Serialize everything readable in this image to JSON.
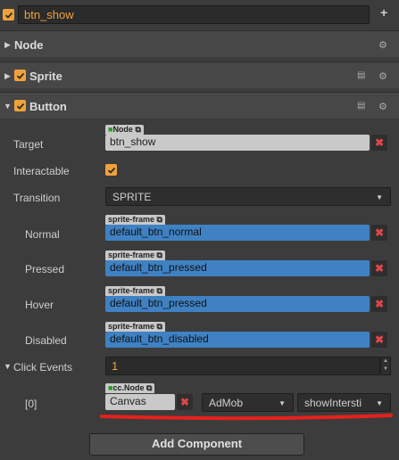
{
  "node": {
    "name": "btn_show",
    "enabled": true
  },
  "sections": {
    "node": {
      "title": "Node"
    },
    "sprite": {
      "title": "Sprite",
      "enabled": true
    },
    "button": {
      "title": "Button",
      "enabled": true
    }
  },
  "button_props": {
    "target": {
      "label": "Target",
      "tag": "Node",
      "value": "btn_show"
    },
    "interactable": {
      "label": "Interactable",
      "checked": true
    },
    "transition": {
      "label": "Transition",
      "value": "SPRITE"
    },
    "normal": {
      "label": "Normal",
      "tag": "sprite-frame",
      "value": "default_btn_normal"
    },
    "pressed": {
      "label": "Pressed",
      "tag": "sprite-frame",
      "value": "default_btn_pressed"
    },
    "hover": {
      "label": "Hover",
      "tag": "sprite-frame",
      "value": "default_btn_pressed"
    },
    "disabled": {
      "label": "Disabled",
      "tag": "sprite-frame",
      "value": "default_btn_disabled"
    },
    "click_events": {
      "label": "Click Events",
      "value": "1"
    }
  },
  "event0": {
    "index_label": "[0]",
    "tag": "cc.Node",
    "target": "Canvas",
    "component": "AdMob",
    "handler": "showIntersti"
  },
  "add_component_label": "Add Component",
  "colors": {
    "accent": "#f0a23a",
    "asset_field": "#3f81c3",
    "remove_x": "#e0464a",
    "annotation": "#e8201c"
  },
  "icons": [
    "checkmark-icon",
    "plus-icon",
    "gear-icon",
    "book-icon",
    "expand-arrow-icon",
    "remove-icon",
    "dropdown-arrow-icon",
    "link-icon"
  ]
}
